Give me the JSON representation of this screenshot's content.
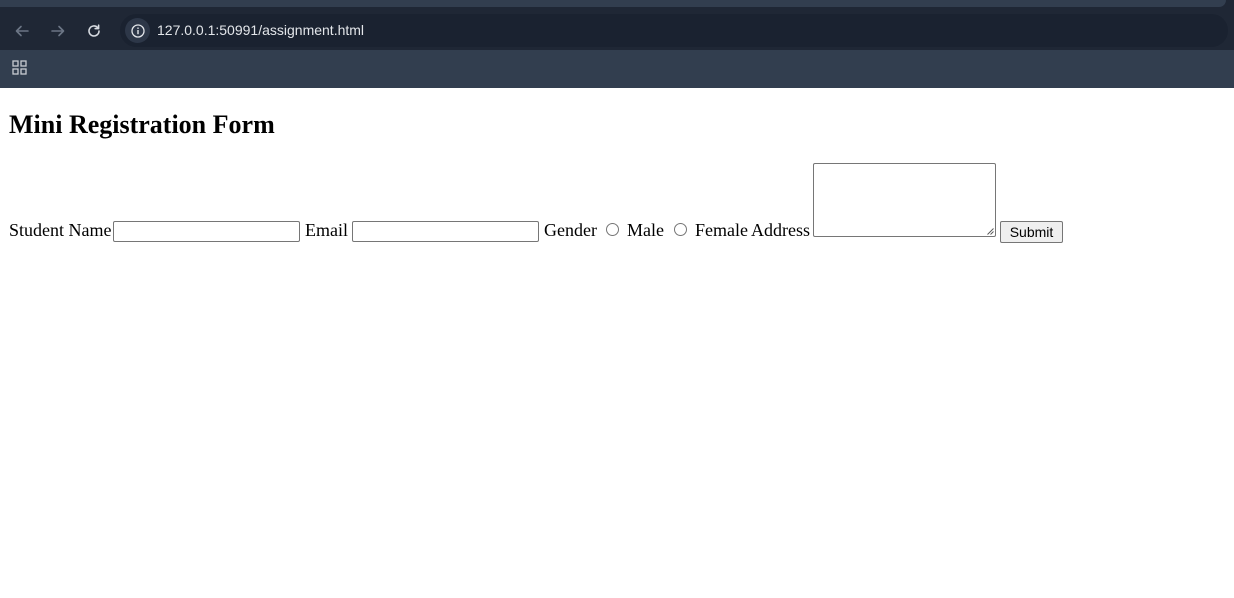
{
  "browser": {
    "url": "127.0.0.1:50991/assignment.html",
    "back_icon": "back-arrow-icon",
    "forward_icon": "forward-arrow-icon",
    "reload_icon": "reload-icon",
    "site_info_icon": "info-icon",
    "apps_icon": "apps-grid-icon",
    "colors": {
      "toolbar": "#1f2735",
      "bookmarks_bar": "#323e4f",
      "omnibox": "#1a2230",
      "url_text": "#e3e6ea"
    }
  },
  "page": {
    "title": "Mini Registration Form",
    "form": {
      "student_name_label": "Student Name",
      "student_name_value": "",
      "email_label": "Email",
      "email_value": "",
      "gender_label": "Gender",
      "gender_options": [
        {
          "label": "Male",
          "checked": false
        },
        {
          "label": "Female",
          "checked": false
        }
      ],
      "address_label": "Address",
      "address_value": "",
      "submit_label": "Submit"
    }
  }
}
